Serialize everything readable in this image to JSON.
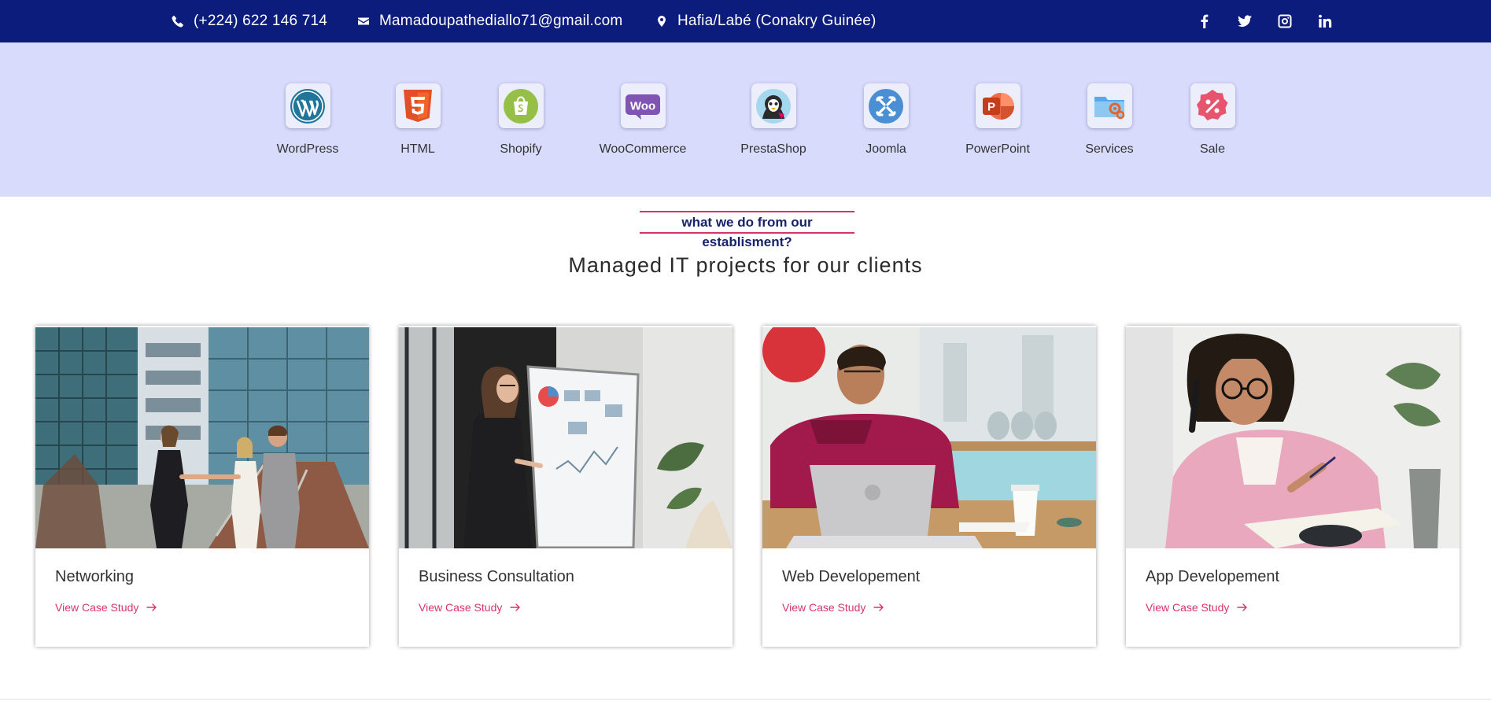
{
  "topbar": {
    "phone": "(+224) 622 146 714",
    "email": "Mamadoupathediallo71@gmail.com",
    "location": "Hafia/Labé (Conakry Guinée)",
    "social": [
      "facebook-icon",
      "twitter-icon",
      "instagram-icon",
      "linkedin-icon"
    ],
    "background": "#0c1c7c"
  },
  "technologies": [
    {
      "label": "WordPress",
      "icon": "wordpress-icon"
    },
    {
      "label": "HTML",
      "icon": "html5-icon"
    },
    {
      "label": "Shopify",
      "icon": "shopify-icon"
    },
    {
      "label": "WooCommerce",
      "icon": "woocommerce-icon"
    },
    {
      "label": "PrestaShop",
      "icon": "prestashop-icon"
    },
    {
      "label": "Joomla",
      "icon": "joomla-icon"
    },
    {
      "label": "PowerPoint",
      "icon": "powerpoint-icon"
    },
    {
      "label": "Services",
      "icon": "services-folder-icon"
    },
    {
      "label": "Sale",
      "icon": "sale-percent-icon"
    }
  ],
  "section": {
    "eyebrow": "what we do from our establisment?",
    "title": "Managed IT projects for our clients"
  },
  "cards": [
    {
      "title": "Networking",
      "link": "View Case Study",
      "image": "business-handshake-photo"
    },
    {
      "title": "Business Consultation",
      "link": "View Case Study",
      "image": "whiteboard-presentation-photo"
    },
    {
      "title": "Web Developement",
      "link": "View Case Study",
      "image": "laptop-cafe-photo"
    },
    {
      "title": "App Developement",
      "link": "View Case Study",
      "image": "woman-phone-notes-photo"
    }
  ],
  "colors": {
    "accent": "#d6336c",
    "navy": "#0c1c7c",
    "band": "#d9dbfd"
  }
}
